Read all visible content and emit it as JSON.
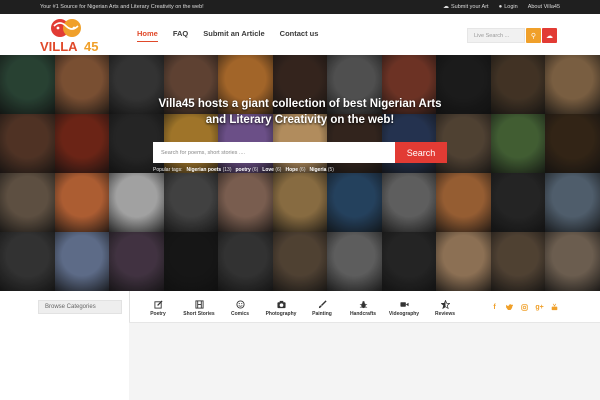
{
  "topbar": {
    "tagline": "Your #1 Source for Nigerian Arts and Literary Creativity on the web!",
    "links": [
      {
        "label": "Submit your Art",
        "icon": "cloud-upload-icon"
      },
      {
        "label": "Login",
        "icon": "user-icon"
      },
      {
        "label": "About Villa45",
        "icon": ""
      }
    ]
  },
  "logo": {
    "text": "VILLA45",
    "colors": {
      "orange": "#f0a02a",
      "red": "#e23b34"
    }
  },
  "nav": [
    {
      "label": "Home",
      "active": true
    },
    {
      "label": "FAQ",
      "active": false
    },
    {
      "label": "Submit an Article",
      "active": false
    },
    {
      "label": "Contact us",
      "active": false
    }
  ],
  "header_search": {
    "placeholder": "Live Search ..."
  },
  "hero": {
    "title": "Villa45 hosts a giant collection of best Nigerian Arts and Literary Creativity on the web!",
    "search_placeholder": "Search for poems, short stories ....",
    "search_button": "Search",
    "popular_label": "Popular tags:",
    "tags": [
      {
        "name": "Nigerian poets",
        "count": "(13)"
      },
      {
        "name": "poetry",
        "count": "(6)"
      },
      {
        "name": "Love",
        "count": "(6)"
      },
      {
        "name": "Hope",
        "count": "(6)"
      },
      {
        "name": "Nigeria",
        "count": "(5)"
      }
    ]
  },
  "browse": {
    "label": "Browse Categories"
  },
  "categories": [
    {
      "label": "Poetry",
      "icon": "pencil-square-icon"
    },
    {
      "label": "Short Stories",
      "icon": "film-icon"
    },
    {
      "label": "Comics",
      "icon": "smiley-icon"
    },
    {
      "label": "Photography",
      "icon": "camera-icon"
    },
    {
      "label": "Painting",
      "icon": "paintbrush-icon"
    },
    {
      "label": "Handcrafts",
      "icon": "bug-icon"
    },
    {
      "label": "Videography",
      "icon": "video-camera-icon"
    },
    {
      "label": "Reviews",
      "icon": "star-half-icon"
    }
  ],
  "socials": [
    {
      "icon": "facebook-icon"
    },
    {
      "icon": "twitter-icon"
    },
    {
      "icon": "instagram-icon"
    },
    {
      "icon": "google-plus-icon"
    },
    {
      "icon": "youtube-icon"
    }
  ],
  "colors": {
    "accent": "#e0492a",
    "orange": "#f0a02a",
    "red": "#e23b34"
  }
}
